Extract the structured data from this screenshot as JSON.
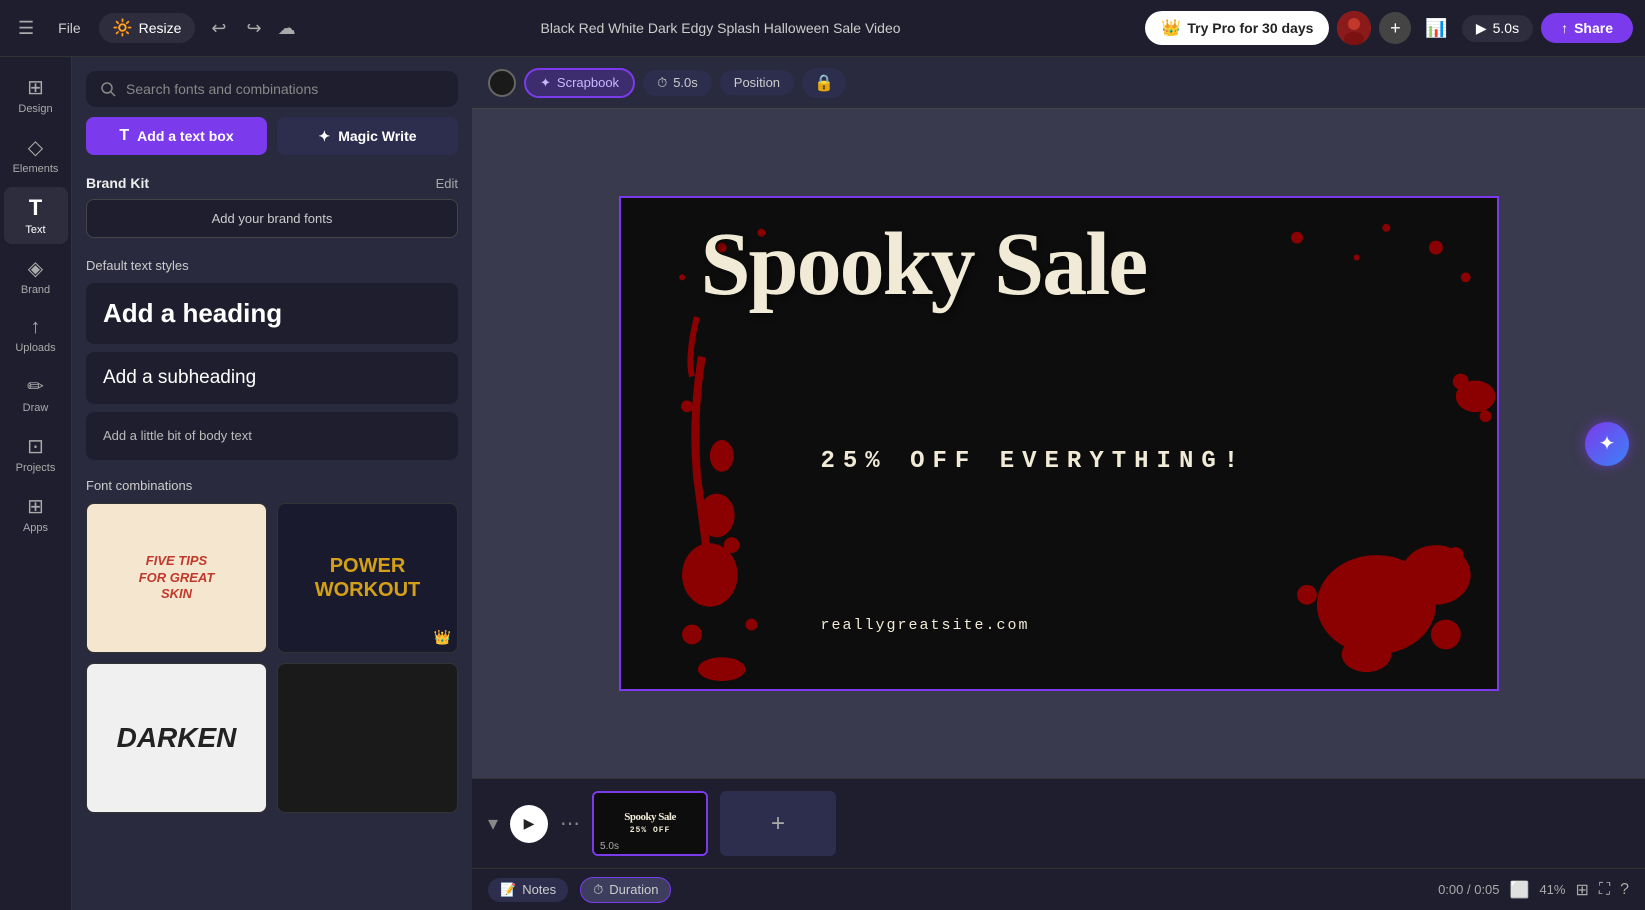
{
  "topbar": {
    "menu_icon": "☰",
    "file_label": "File",
    "resize_label": "Resize",
    "resize_emoji": "🔆",
    "title": "Black Red White Dark Edgy Splash Halloween Sale Video",
    "pro_label": "Try Pro for 30 days",
    "pro_crown": "👑",
    "timer_label": "5.0s",
    "share_label": "Share",
    "share_icon": "↑",
    "undo_icon": "↩",
    "redo_icon": "↪",
    "cloud_icon": "☁"
  },
  "sidebar": {
    "items": [
      {
        "id": "design",
        "label": "Design",
        "icon": "⊞"
      },
      {
        "id": "elements",
        "label": "Elements",
        "icon": "◇"
      },
      {
        "id": "text",
        "label": "Text",
        "icon": "T"
      },
      {
        "id": "brand",
        "label": "Brand",
        "icon": "◈"
      },
      {
        "id": "uploads",
        "label": "Uploads",
        "icon": "↑"
      },
      {
        "id": "draw",
        "label": "Draw",
        "icon": "✏"
      },
      {
        "id": "projects",
        "label": "Projects",
        "icon": "⊡"
      },
      {
        "id": "apps",
        "label": "Apps",
        "icon": "⊞"
      }
    ]
  },
  "panel": {
    "search_placeholder": "Search fonts and combinations",
    "add_text_box_label": "Add a text box",
    "magic_write_label": "Magic Write",
    "brand_kit_label": "Brand Kit",
    "brand_kit_edit": "Edit",
    "brand_fonts_btn": "Add your brand fonts",
    "default_text_styles": "Default text styles",
    "heading_label": "Add a heading",
    "subheading_label": "Add a subheading",
    "body_label": "Add a little bit of body text",
    "font_combinations": "Font combinations",
    "combo1_line1": "FIVE TIPS",
    "combo1_line2": "FOR GREAT",
    "combo1_line3": "SKIN",
    "combo2_line1": "POWER",
    "combo2_line2": "WORKOUT",
    "combo3_text": "DARKEN"
  },
  "toolbar": {
    "scrapbook_label": "Scrapbook",
    "scrapbook_icon": "✦",
    "time_label": "5.0s",
    "time_icon": "⏱",
    "position_label": "Position",
    "lock_icon": "🔒"
  },
  "canvas": {
    "spooky_title_line1": "Spooky",
    "spooky_title_line2": "Sale",
    "subtitle": "25% OFF EVERYTHING!",
    "url": "reallygreatsite.com"
  },
  "filmstrip": {
    "play_icon": "▶",
    "slide_label": "5.0s",
    "slide_text": "Spooky Sale",
    "add_icon": "+"
  },
  "status": {
    "notes_icon": "📝",
    "notes_label": "Notes",
    "duration_icon": "⏱",
    "duration_label": "Duration",
    "time": "0:00 / 0:05",
    "screen_icon": "⬜",
    "zoom": "41%",
    "grid_icon": "⊞",
    "fullscreen_icon": "⛶",
    "help_icon": "?"
  }
}
